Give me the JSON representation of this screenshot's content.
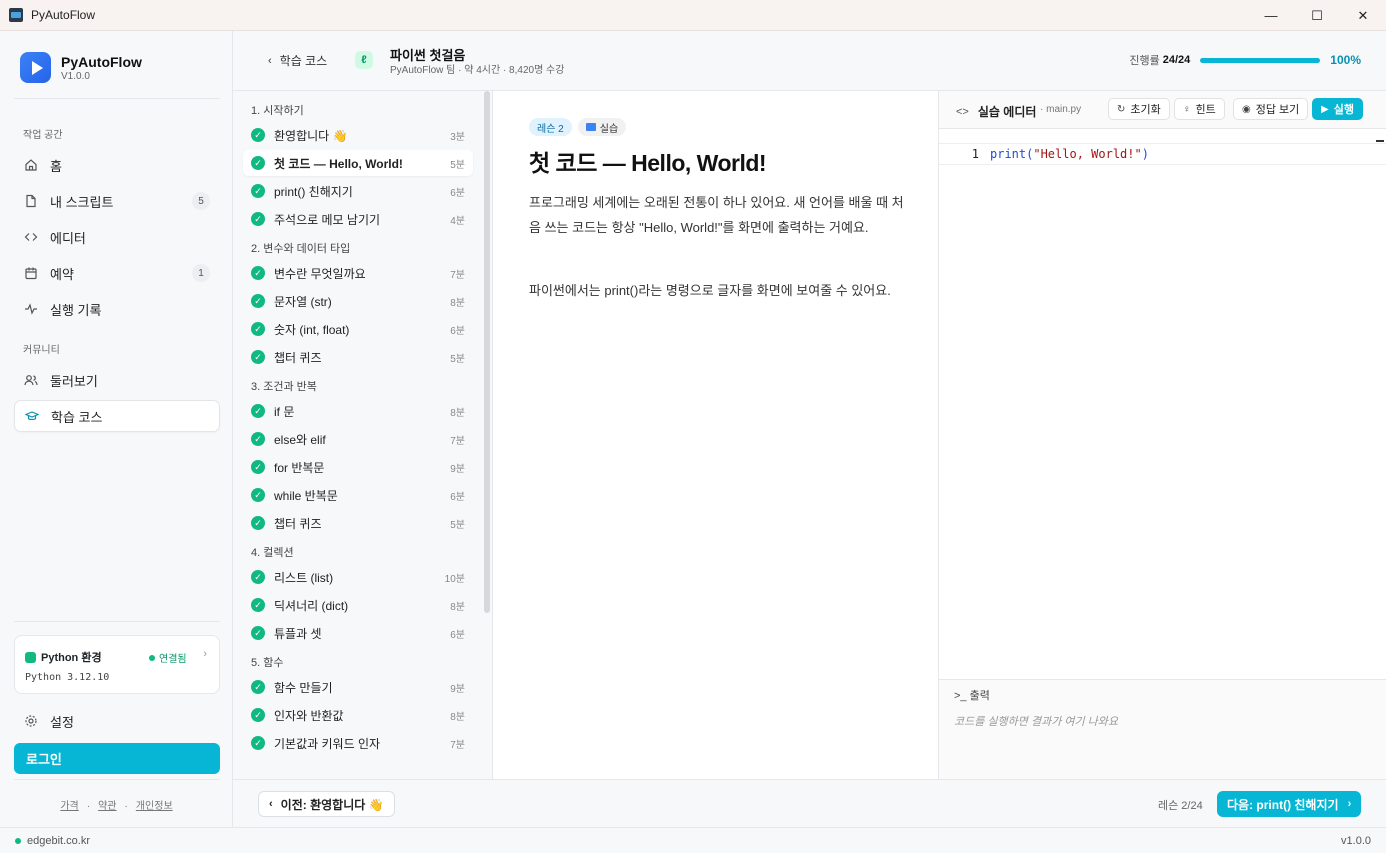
{
  "window": {
    "title": "PyAutoFlow",
    "minimize": "—",
    "maximize": "☐",
    "close": "✕"
  },
  "brand": {
    "name": "PyAutoFlow",
    "version": "V1.0.0"
  },
  "sidebar": {
    "workspace_label": "작업 공간",
    "community_label": "커뮤니티",
    "items": [
      {
        "label": "홈",
        "icon": "home-icon"
      },
      {
        "label": "내 스크립트",
        "icon": "file-icon",
        "badge": "5"
      },
      {
        "label": "에디터",
        "icon": "code-icon"
      },
      {
        "label": "예약",
        "icon": "calendar-icon",
        "badge": "1"
      },
      {
        "label": "실행 기록",
        "icon": "activity-icon"
      },
      {
        "label": "둘러보기",
        "icon": "users-icon"
      },
      {
        "label": "학습 코스",
        "icon": "graduation-cap-icon"
      }
    ],
    "python_env": {
      "title": "Python 환경",
      "status": "연결됨",
      "version": "Python 3.12.10"
    },
    "settings_label": "설정",
    "login_label": "로그인",
    "footer_links": [
      "가격",
      "약관",
      "개인정보"
    ]
  },
  "header": {
    "back_label": "학습 코스",
    "course_title": "파이썬 첫걸음",
    "course_sub": "PyAutoFlow 팀 · 약 4시간 · 8,420명 수강",
    "progress_label": "진행률",
    "progress_count": "24/24",
    "progress_fraction": 1.0,
    "progress_pct": "100%"
  },
  "lessons": {
    "sections": [
      {
        "title": "1. 시작하기",
        "items": [
          {
            "label": "환영합니다 👋",
            "dur": "3분"
          },
          {
            "label": "첫 코드 — Hello, World!",
            "dur": "5분",
            "active": true
          },
          {
            "label": "print() 친해지기",
            "dur": "6분"
          },
          {
            "label": "주석으로 메모 남기기",
            "dur": "4분"
          }
        ]
      },
      {
        "title": "2. 변수와 데이터 타입",
        "items": [
          {
            "label": "변수란 무엇일까요",
            "dur": "7분"
          },
          {
            "label": "문자열 (str)",
            "dur": "8분"
          },
          {
            "label": "숫자 (int, float)",
            "dur": "6분"
          },
          {
            "label": "챕터 퀴즈",
            "dur": "5분"
          }
        ]
      },
      {
        "title": "3. 조건과 반복",
        "items": [
          {
            "label": "if 문",
            "dur": "8분"
          },
          {
            "label": "else와 elif",
            "dur": "7분"
          },
          {
            "label": "for 반복문",
            "dur": "9분"
          },
          {
            "label": "while 반복문",
            "dur": "6분"
          },
          {
            "label": "챕터 퀴즈",
            "dur": "5분"
          }
        ]
      },
      {
        "title": "4. 컬렉션",
        "items": [
          {
            "label": "리스트 (list)",
            "dur": "10분"
          },
          {
            "label": "딕셔너리 (dict)",
            "dur": "8분"
          },
          {
            "label": "튜플과 셋",
            "dur": "6분"
          }
        ]
      },
      {
        "title": "5. 함수",
        "items": [
          {
            "label": "함수 만들기",
            "dur": "9분"
          },
          {
            "label": "인자와 반환값",
            "dur": "8분"
          },
          {
            "label": "기본값과 키워드 인자",
            "dur": "7분"
          }
        ]
      }
    ]
  },
  "lesson": {
    "tag_lesson": "레슨 2",
    "tag_practice": "실습",
    "title": "첫 코드 — Hello, World!",
    "p1": "프로그래밍 세계에는 오래된 전통이 하나 있어요. 새 언어를 배울 때 처음 쓰는 코드는 항상 \"Hello, World!\"를 화면에 출력하는 거예요.",
    "p2": "파이썬에서는 print()라는 명령으로 글자를 화면에 보여줄 수 있어요."
  },
  "editor": {
    "title": "실습 에디터",
    "filename": "· main.py",
    "reset_label": "초기화",
    "hint_label": "힌트",
    "answer_label": "정답 보기",
    "run_label": "실행",
    "line_no": "1",
    "code_fn": "print(",
    "code_str": "\"Hello, World!\"",
    "code_end": ")",
    "output_label": "출력",
    "output_placeholder": "코드를 실행하면 결과가 여기 나와요"
  },
  "footer_nav": {
    "prev_label": "이전: 환영합니다 👋",
    "lesson_count": "레슨 2/24",
    "next_label": "다음: print() 친해지기"
  },
  "statusbar": {
    "domain": "edgebit.co.kr",
    "version": "v1.0.0"
  },
  "colors": {
    "accent": "#06b6d4",
    "success": "#10b981",
    "brand": "#2563eb"
  }
}
